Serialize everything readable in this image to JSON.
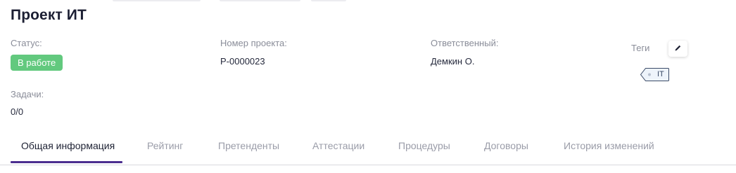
{
  "title": "Проект ИТ",
  "fields": {
    "status_label": "Статус:",
    "status_value": "В работе",
    "status_color": "#62c97e",
    "project_number_label": "Номер проекта:",
    "project_number_value": "Р-0000023",
    "responsible_label": "Ответственный:",
    "responsible_value": "Демкин О.",
    "tasks_label": "Задачи:",
    "tasks_value": "0/0"
  },
  "tags": {
    "label": "Теги",
    "edit_icon": "pencil-icon",
    "items": [
      "IT"
    ]
  },
  "tabs": [
    {
      "label": "Общая информация",
      "active": true
    },
    {
      "label": "Рейтинг",
      "active": false
    },
    {
      "label": "Претенденты",
      "active": false
    },
    {
      "label": "Аттестации",
      "active": false
    },
    {
      "label": "Процедуры",
      "active": false
    },
    {
      "label": "Договоры",
      "active": false
    },
    {
      "label": "История изменений",
      "active": false
    }
  ],
  "colors": {
    "accent": "#4b2e8f",
    "title": "#1c1f33",
    "label": "#8a8d99"
  }
}
